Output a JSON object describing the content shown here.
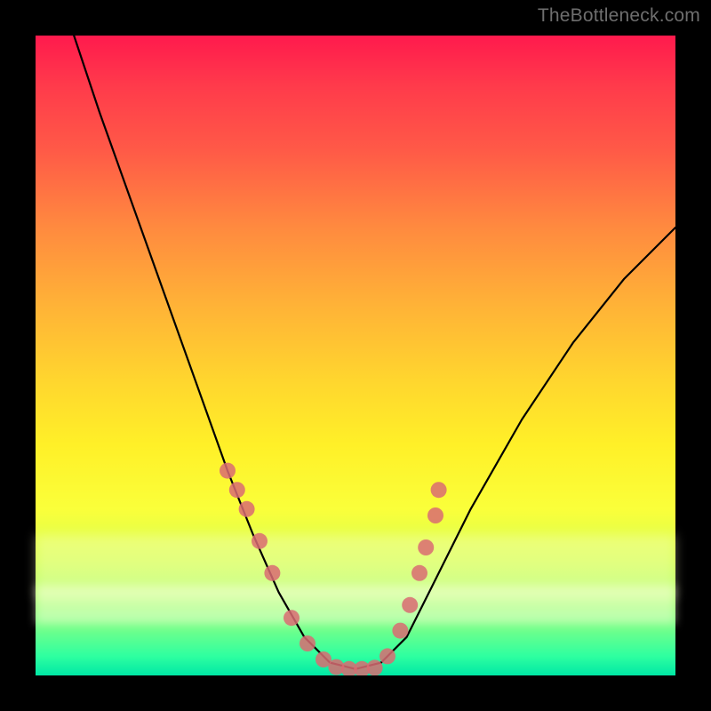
{
  "watermark": "TheBottleneck.com",
  "chart_data": {
    "type": "line",
    "title": "",
    "xlabel": "",
    "ylabel": "",
    "xlim": [
      0,
      100
    ],
    "ylim": [
      0,
      100
    ],
    "series": [
      {
        "name": "curve",
        "x": [
          6,
          10,
          15,
          20,
          25,
          30,
          34,
          38,
          42,
          46,
          50,
          54,
          58,
          62,
          68,
          76,
          84,
          92,
          100
        ],
        "y": [
          100,
          88,
          74,
          60,
          46,
          32,
          22,
          13,
          6,
          2,
          1,
          2,
          6,
          14,
          26,
          40,
          52,
          62,
          70
        ]
      }
    ],
    "markers": {
      "name": "highlight-points",
      "color": "#d96b72",
      "x": [
        30,
        31.5,
        33,
        35,
        37,
        40,
        42.5,
        45,
        47,
        49,
        51,
        53,
        55,
        57,
        58.5,
        60,
        61,
        62.5,
        63
      ],
      "y": [
        32,
        29,
        26,
        21,
        16,
        9,
        5,
        2.5,
        1.3,
        1,
        1,
        1.2,
        3,
        7,
        11,
        16,
        20,
        25,
        29
      ]
    },
    "background_gradient": {
      "top": "#ff1a4d",
      "mid": "#ffe028",
      "bottom": "#00e8a5"
    }
  }
}
